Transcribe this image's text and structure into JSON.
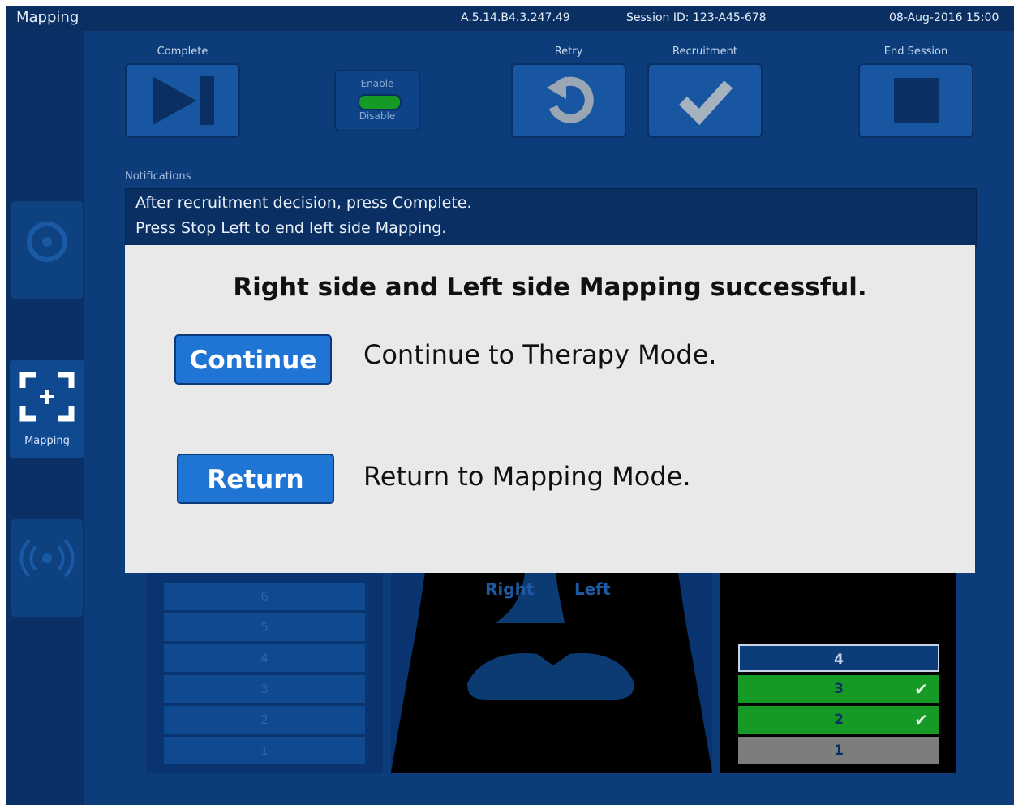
{
  "topbar": {
    "title": "Mapping",
    "version": "A.5.14.B4.3.247.49",
    "session": "Session ID: 123-A45-678",
    "datetime": "08-Aug-2016  15:00"
  },
  "sidebar": {
    "mapping_label": "Mapping"
  },
  "toolbar": {
    "complete_label": "Complete",
    "enable_label": "Enable",
    "disable_label": "Disable",
    "retry_label": "Retry",
    "recruitment_label": "Recruitment",
    "end_session_label": "End Session"
  },
  "notifications": {
    "label": "Notifications",
    "lines": [
      "After recruitment decision, press Complete.",
      "Press Stop Left to end left side Mapping."
    ]
  },
  "background": {
    "left_rows": [
      "6",
      "5",
      "4",
      "3",
      "2",
      "1"
    ],
    "body_labels": [
      "Right",
      "Left"
    ],
    "levels": [
      {
        "label": "4",
        "status": "current"
      },
      {
        "label": "3",
        "status": "done"
      },
      {
        "label": "2",
        "status": "done"
      },
      {
        "label": "1",
        "status": "inactive"
      }
    ]
  },
  "modal": {
    "title": "Right side and Left side Mapping successful.",
    "continue_label": "Continue",
    "continue_desc": "Continue to Therapy Mode.",
    "return_label": "Return",
    "return_desc": "Return to Mapping Mode."
  },
  "colors": {
    "background": "#0c3d7a",
    "topbar": "#0a2f63",
    "button": "#1f74d4",
    "modal": "#e9e9e9",
    "done_green": "#159a26"
  }
}
